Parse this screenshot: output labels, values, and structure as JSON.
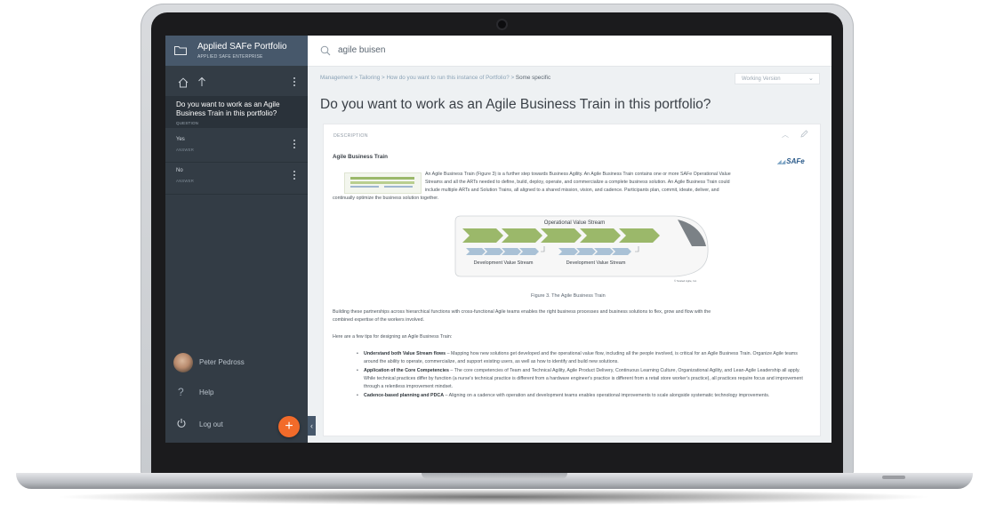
{
  "sidebar": {
    "portfolio_title": "Applied SAFe Portfolio",
    "portfolio_subtitle": "APPLIED SAFE ENTERPRISE",
    "active_item": {
      "title": "Do you want to work as an Agile Business Train in this portfolio?",
      "type": "QUESTION"
    },
    "items": [
      {
        "label": "Yes",
        "type": "ANSWER"
      },
      {
        "label": "No",
        "type": "ANSWER"
      }
    ],
    "user_name": "Peter Pedross",
    "help_label": "Help",
    "logout_label": "Log out",
    "fab_label": "+",
    "collapse_label": "‹"
  },
  "search": {
    "value": "agile buisen"
  },
  "breadcrumb": {
    "path": "Management > Tailoring > How do you want to run this instance of Portfolio? > ",
    "current": "Some specific"
  },
  "version_select": {
    "value": "Working Version"
  },
  "page": {
    "title": "Do you want to work as an Agile Business Train in this portfolio?"
  },
  "card": {
    "label": "DESCRIPTION",
    "section_title": "Agile Business Train",
    "logo_text": "SAFe",
    "intro_lines": [
      "An Agile Business Train (Figure 3) is a further step towards Business Agility. An Agile Business Train contains one or more SAFe Operational Value",
      "Streams and all the ARTs needed to define, build, deploy, operate, and commercialize a complete business solution. An Agile Business Train could",
      "include multiple ARTs and Solution Trains, all aligned to a shared mission, vision, and cadence. Participants plan, commit, ideate, deliver, and"
    ],
    "intro_last_line": "continually optimize the business solution together.",
    "figure": {
      "top_label": "Operational Value Stream",
      "left_label": "Development Value Stream",
      "right_label": "Development Value Stream",
      "credit": "© Scaled Agile, Inc.",
      "caption": "Figure 3. The Agile Business Train"
    },
    "para2_lines": [
      "Building these partnerships across hierarchical functions with cross-functional Agile teams enables the right business processes and business solutions to flex, grow and flow with the",
      "combined expertise of the workers involved."
    ],
    "para3": "Here are a few tips for designing an Agile Business Train:",
    "tips": [
      {
        "title": "Understand both Value Stream flows",
        "text": " – Mapping how new solutions get developed and the operational value flow, including all the people involved, is critical for an Agile Business Train. Organize Agile teams around the ability to operate, commercialize, and support existing users, as well as how to identify and build new solutions."
      },
      {
        "title": "Application of the Core Competencies",
        "text": " – The core competencies of Team and Technical Agility, Agile Product Delivery, Continuous Learning Culture, Organizational Agility, and Lean-Agile Leadership all apply. While technical practices differ by function (a nurse's technical practice is different from a hardware engineer's practice is different from a retail store worker's practice), all practices require focus and improvement through a relentless improvement mindset."
      },
      {
        "title": "Cadence-based planning and PDCA",
        "text": " – Aligning on a cadence with operation and development teams enables operational improvements to scale alongside systematic technology improvements."
      }
    ]
  },
  "colors": {
    "sidebar_bg": "#333c45",
    "sidebar_header": "#47586b",
    "fab": "#f26b2a",
    "link": "#8aa2b6",
    "chevron_green": "#9bb86a",
    "chevron_blue": "#9fb7cf"
  },
  "icons": [
    "folder-icon",
    "home-icon",
    "arrow-up-icon",
    "more-vert-icon",
    "help-icon",
    "power-icon",
    "search-icon",
    "chevron-down-icon",
    "chevron-up-icon",
    "pencil-icon"
  ]
}
